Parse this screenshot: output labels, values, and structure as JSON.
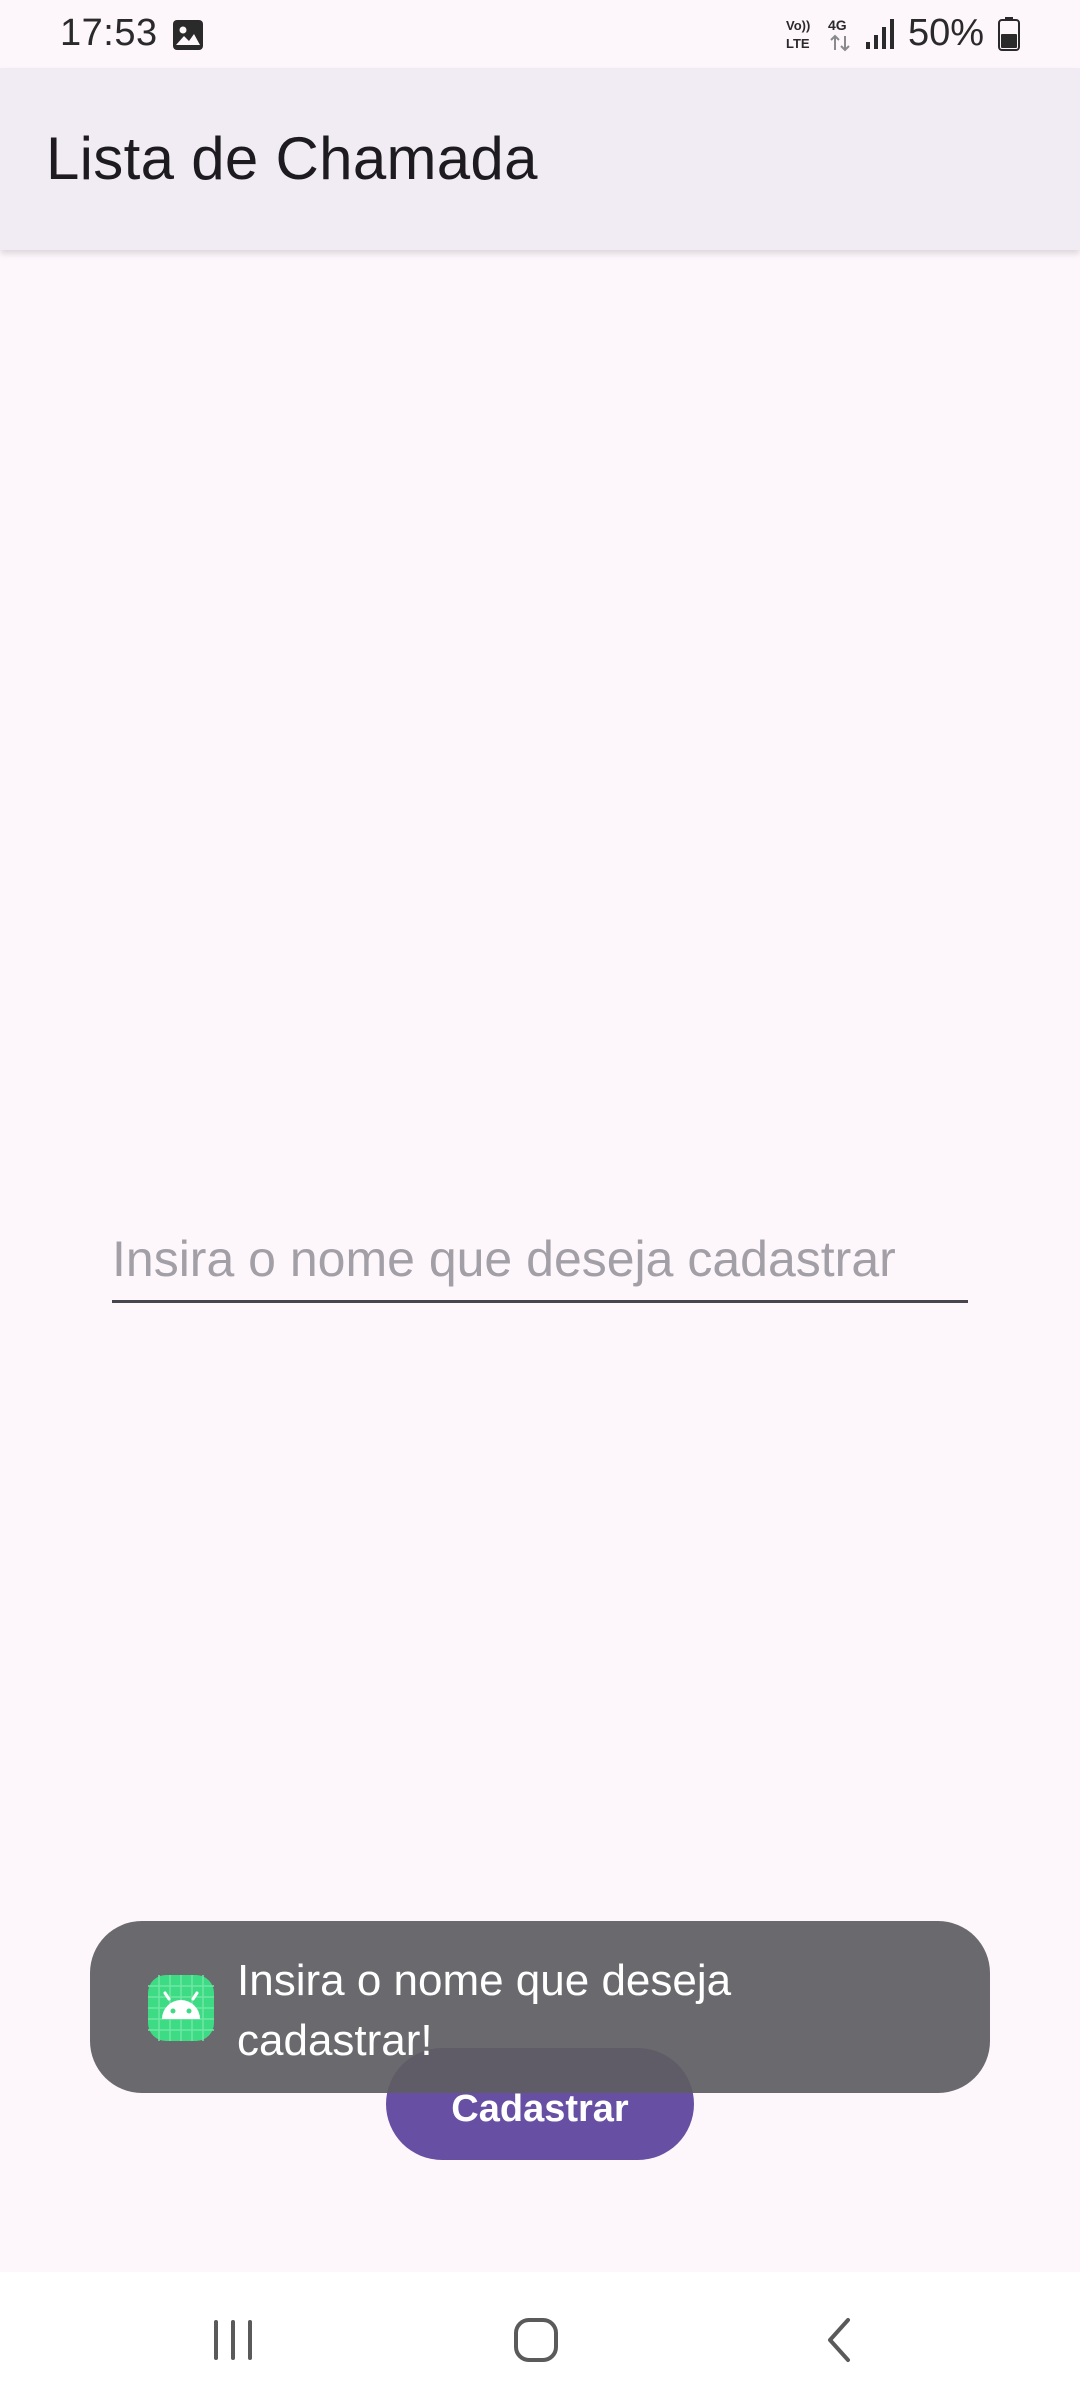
{
  "status_bar": {
    "time": "17:53",
    "battery_percent": "50%",
    "icons": [
      "gallery-icon",
      "volte-icon",
      "network-4g-icon",
      "signal-icon",
      "battery-icon"
    ]
  },
  "app_bar": {
    "title": "Lista de Chamada"
  },
  "form": {
    "name_placeholder": "Insira o nome que deseja cadastrar",
    "name_value": "",
    "register_label": "Cadastrar"
  },
  "toast": {
    "message": "Insira o nome que deseja cadastrar!",
    "icon": "android-icon"
  },
  "nav_bar": {
    "icons": [
      "recents-icon",
      "home-icon",
      "back-icon"
    ]
  },
  "colors": {
    "background": "#fdf7fc",
    "app_bar": "#f1ecf4",
    "primary": "#6750a4",
    "toast": "#5f5e62",
    "android_green": "#3ddc84"
  }
}
